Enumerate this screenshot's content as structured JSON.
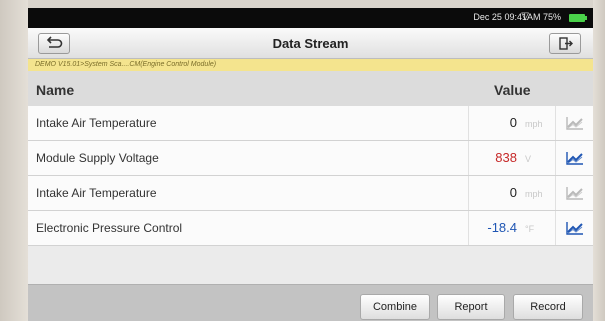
{
  "status": {
    "datetime": "Dec 25 09:41AM",
    "battery": "75%"
  },
  "header": {
    "title": "Data Stream"
  },
  "breadcrumb": "DEMO V15.01>System Sca....CM(Engine Control Module)",
  "columns": {
    "name": "Name",
    "value": "Value"
  },
  "rows": [
    {
      "name": "Intake Air Temperature",
      "value": "0",
      "unit": "mph",
      "value_color": "#222222",
      "chart_active": false
    },
    {
      "name": "Module Supply Voltage",
      "value": "838",
      "unit": "V",
      "value_color": "#c62828",
      "chart_active": true
    },
    {
      "name": "Intake Air Temperature",
      "value": "0",
      "unit": "mph",
      "value_color": "#222222",
      "chart_active": false
    },
    {
      "name": "Electronic Pressure Control",
      "value": "-18.4",
      "unit": "°F",
      "value_color": "#1e55b3",
      "chart_active": true
    }
  ],
  "actions": {
    "combine": "Combine",
    "report": "Report",
    "record": "Record"
  },
  "icons": {
    "back": "back-arrow-icon",
    "exit": "exit-icon",
    "chart": "line-chart-icon",
    "wifi": "wifi-icon",
    "battery": "battery-icon"
  }
}
